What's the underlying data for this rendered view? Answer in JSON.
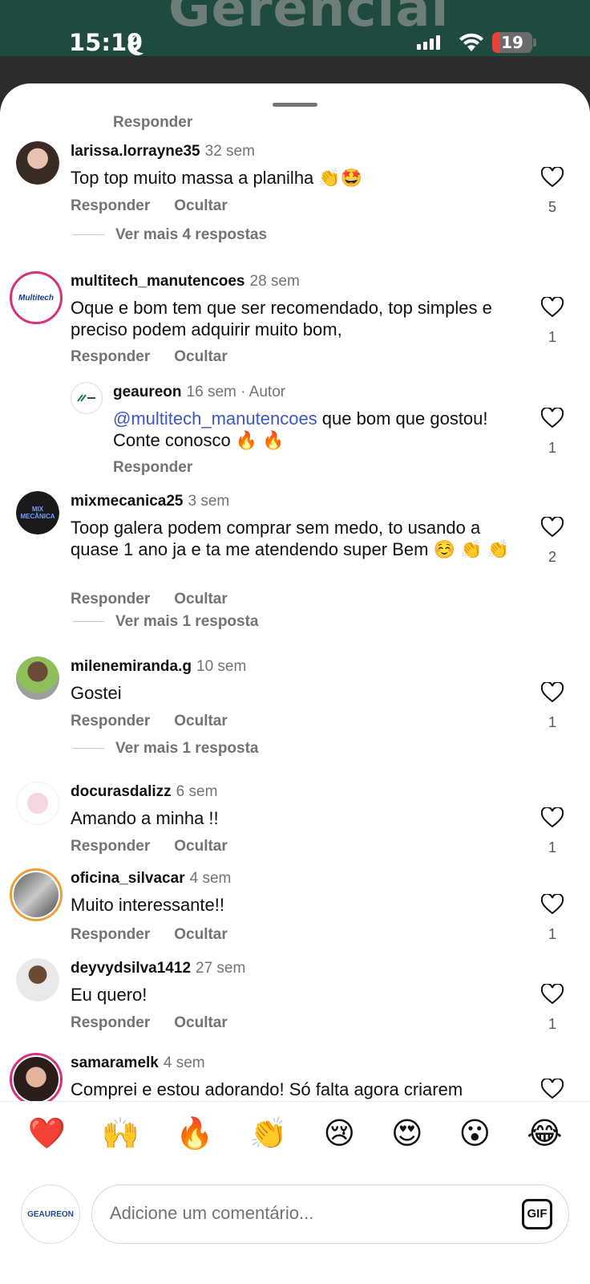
{
  "status_bar": {
    "time": "15:19",
    "battery": "19"
  },
  "background": {
    "title_fragment": "Gerencial"
  },
  "top_reply": "Responder",
  "comments": [
    {
      "user": "larissa.lorrayne35",
      "when": "32 sem",
      "text": "Top top muito massa a planilha 👏🤩",
      "reply": "Responder",
      "hide": "Ocultar",
      "likes": "5",
      "more": "Ver mais 4 respostas"
    },
    {
      "user": "multitech_manutencoes",
      "when": "28 sem",
      "text": "Oque e bom tem que ser recomendado, top simples e preciso  podem adquirir muito bom,",
      "reply": "Responder",
      "hide": "Ocultar",
      "likes": "1",
      "avatar_text": "Multitech"
    },
    {
      "user": "geaureon",
      "when": "16 sem · Autor",
      "mention": "@multitech_manutencoes",
      "text": " que bom que gostou! Conte conosco 🔥 🔥",
      "reply": "Responder",
      "likes": "1"
    },
    {
      "user": "mixmecanica25",
      "when": "3 sem",
      "text": "Toop galera podem comprar sem medo, to usando a quase 1 ano ja e ta me atendendo super Bem ☺️ 👏 👏",
      "reply": "Responder",
      "hide": "Ocultar",
      "likes": "2",
      "more": "Ver mais 1 resposta",
      "avatar_text": "MIX MECÂNICA"
    },
    {
      "user": "milenemiranda.g",
      "when": "10 sem",
      "text": "Gostei",
      "reply": "Responder",
      "hide": "Ocultar",
      "likes": "1",
      "more": "Ver mais 1 resposta"
    },
    {
      "user": "docurasdalizz",
      "when": "6 sem",
      "text": "Amando a minha !!",
      "reply": "Responder",
      "hide": "Ocultar",
      "likes": "1"
    },
    {
      "user": "oficina_silvacar",
      "when": "4 sem",
      "text": "Muito interessante!!",
      "reply": "Responder",
      "hide": "Ocultar",
      "likes": "1"
    },
    {
      "user": "deyvydsilva1412",
      "when": "27 sem",
      "text": "Eu quero!",
      "reply": "Responder",
      "hide": "Ocultar",
      "likes": "1"
    },
    {
      "user": "samaramelk",
      "when": "4 sem",
      "text": "Comprei e estou adorando! Só falta agora criarem"
    }
  ],
  "reactions": [
    "❤️",
    "🙌",
    "🔥",
    "👏",
    "😢",
    "😍",
    "😮",
    "😂"
  ],
  "composer": {
    "placeholder": "Adicione um comentário...",
    "gif": "GIF",
    "self_avatar": "GEAUREON"
  },
  "colors": {
    "accent_mention": "#3c55c8",
    "ring": "#d9307a",
    "muted": "#737373"
  }
}
